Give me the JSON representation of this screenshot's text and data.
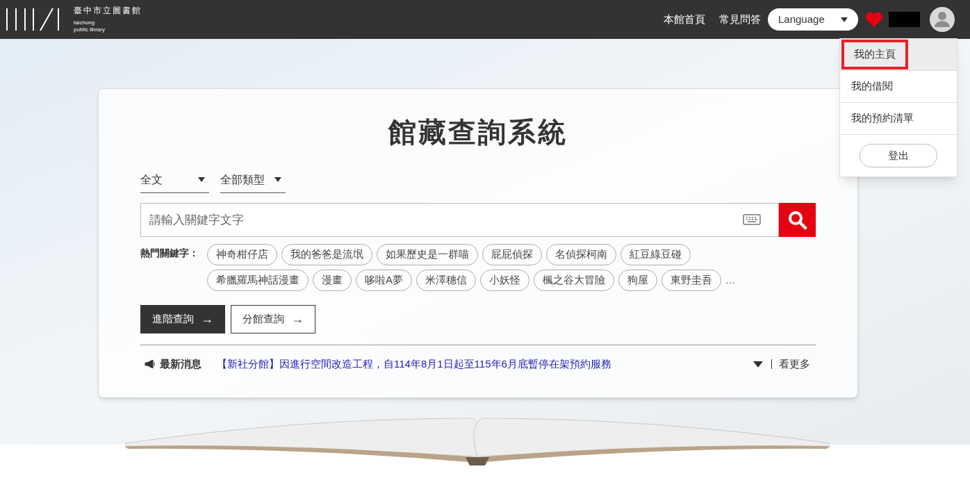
{
  "header": {
    "logo": {
      "name_zh": "臺中市立圖書館",
      "name_en_1": "taichung",
      "name_en_2": "public library"
    },
    "nav": [
      "本館首頁",
      "常見問答"
    ],
    "language": {
      "label": "Language"
    },
    "user_menu": {
      "expanded": true,
      "items": [
        {
          "label": "我的主頁",
          "selected": true
        },
        {
          "label": "我的借閱",
          "selected": false
        },
        {
          "label": "我的預約清單",
          "selected": false
        }
      ],
      "logout": "登出"
    }
  },
  "search": {
    "title": "館藏查詢系統",
    "filters": [
      {
        "value": "全文"
      },
      {
        "value": "全部類型"
      }
    ],
    "placeholder": "請輸入關鍵字文字",
    "hot_label": "熱門關鍵字：",
    "hot_keywords": [
      "神奇柑仔店",
      "我的爸爸是流氓",
      "如果歷史是一群喵",
      "屁屁偵探",
      "名偵探柯南",
      "紅豆綠豆碰",
      "希臘羅馬神話漫畫",
      "漫畫",
      "哆啦A夢",
      "米澤穗信",
      "小妖怪",
      "楓之谷大冒險",
      "狗屋",
      "東野圭吾"
    ],
    "more": "…",
    "buttons": [
      {
        "label": "進階查詢",
        "arrow": "→",
        "kind": "primary"
      },
      {
        "label": "分館查詢",
        "arrow": "→",
        "kind": "outline"
      }
    ]
  },
  "news": {
    "label": "最新消息",
    "headline": "【新社分館】因進行空間改造工程，自114年8月1日起至115年6月底暫停在架預約服務",
    "more": "看更多"
  }
}
